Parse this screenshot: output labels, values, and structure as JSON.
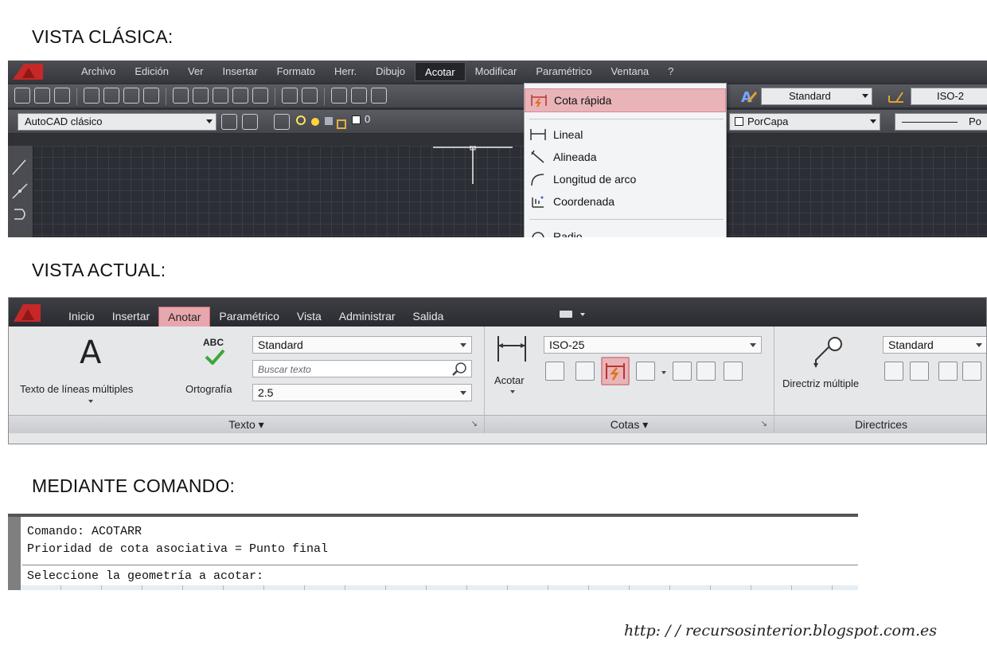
{
  "sections": {
    "classic_title": "VISTA CLÁSICA:",
    "ribbon_title": "VISTA ACTUAL:",
    "command_title": "MEDIANTE COMANDO:"
  },
  "classic": {
    "menu": [
      "Archivo",
      "Edición",
      "Ver",
      "Insertar",
      "Formato",
      "Herr.",
      "Dibujo",
      "Acotar",
      "Modificar",
      "Paramétrico",
      "Ventana",
      "?"
    ],
    "active_menu": "Acotar",
    "toolbar_right": {
      "text_style": "Standard",
      "dim_style": "ISO-2"
    },
    "workspace_combo": "AutoCAD clásico",
    "layer_value": "0",
    "color_combo": "PorCapa",
    "linetype_combo": "Po",
    "dropdown": {
      "items": [
        "Cota rápida",
        "Lineal",
        "Alineada",
        "Longitud de arco",
        "Coordenada",
        "Radio"
      ],
      "highlighted": "Cota rápida"
    }
  },
  "ribbon": {
    "tabs": [
      "Inicio",
      "Insertar",
      "Anotar",
      "Paramétrico",
      "Vista",
      "Administrar",
      "Salida"
    ],
    "active_tab": "Anotar",
    "text_panel": {
      "big_button_label": "Texto de líneas múltiples",
      "spell_label": "Ortografía",
      "spell_icon_text": "ABC",
      "style_combo": "Standard",
      "search_placeholder": "Buscar texto",
      "height_combo": "2.5",
      "footer": "Texto ▾"
    },
    "dim_panel": {
      "big_button_label": "Acotar",
      "style_combo": "ISO-25",
      "footer": "Cotas ▾"
    },
    "leader_panel": {
      "big_button_label": "Directriz múltiple",
      "style_combo": "Standard",
      "footer": "Directrices"
    }
  },
  "command": {
    "lines": [
      "Comando: ACOTARR",
      "Prioridad de cota asociativa = Punto final",
      "Seleccione la geometría a acotar:"
    ]
  },
  "footer_url": "http: / / recursosinterior.blogspot.com.es",
  "colors": {
    "highlight": "#e8b4b8",
    "dark_ui": "#2f3137",
    "ribbon_bg": "#e6e7e9"
  }
}
